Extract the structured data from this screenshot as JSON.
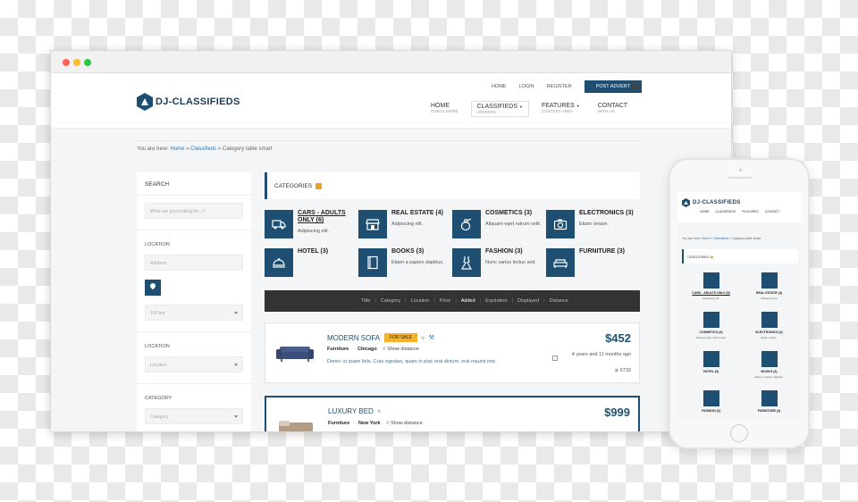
{
  "site": {
    "logo_text": "DJ-CLASSIFIEDS",
    "brand_color": "#1e4f72",
    "accent_color": "#f5b22a"
  },
  "window": {
    "dots": [
      "#ff5f57",
      "#ffbd2e",
      "#28c840"
    ]
  },
  "topnav": {
    "home": "HOME",
    "login": "LOGIN",
    "register": "REGISTER",
    "post_advert": "POST ADVERT"
  },
  "mainnav": [
    {
      "label": "HOME",
      "sub": "CHECK MORE"
    },
    {
      "label": "CLASSIFIEDS",
      "sub": "ADVERTS"
    },
    {
      "label": "FEATURES",
      "sub": "CONTENT AREA"
    },
    {
      "label": "CONTACT",
      "sub": "WITH US"
    }
  ],
  "breadcrumb": {
    "prefix": "You are here:",
    "home": "Home",
    "classifieds": "Classifieds",
    "current": "Category table smart"
  },
  "sidebar": {
    "title": "SEARCH",
    "search_placeholder": "What are you looking for...?",
    "location_label": "LOCATION",
    "address_placeholder": "Address",
    "radius_value": "100 km",
    "location_label2": "LOCATION",
    "location_select": "Location",
    "category_label": "CATEGORY",
    "category_select": "Category"
  },
  "categories": {
    "title": "CATEGORIES",
    "items": [
      {
        "name": "CARS - ADULTS ONLY (6)",
        "desc": "Adipiscing elit.",
        "icon": "truck-icon"
      },
      {
        "name": "REAL ESTATE (4)",
        "desc": "Adipiscing elit.",
        "icon": "store-icon"
      },
      {
        "name": "COSMETICS (3)",
        "desc": "Aliquam eget rutrum velit.",
        "icon": "perfume-icon"
      },
      {
        "name": "ELECTRONICS (3)",
        "desc": "Etiam ornare.",
        "icon": "camera-icon"
      },
      {
        "name": "HOTEL (3)",
        "desc": "",
        "icon": "cloche-icon"
      },
      {
        "name": "BOOKS (3)",
        "desc": "Etiam a sapien dapibus.",
        "icon": "book-icon"
      },
      {
        "name": "FASHION (3)",
        "desc": "Nunc varius lectus sed.",
        "icon": "dress-icon"
      },
      {
        "name": "FURNITURE (3)",
        "desc": "",
        "icon": "sofa-icon"
      }
    ]
  },
  "sortbar": [
    "Title",
    "Category",
    "Location",
    "Price",
    "Added",
    "Expiration",
    "Displayed",
    "Distance"
  ],
  "listings": [
    {
      "title": "MODERN SOFA",
      "badge": "FOR SALE",
      "category": "Furniture",
      "city": "Chicago",
      "distance": "Show distance",
      "desc": "Donec ut quam felis. Cras egestas, quam in plac erat dictum, erat mauris inte.",
      "price": "$452",
      "ago": "4 years and 11 months ago",
      "views": "6733"
    },
    {
      "title": "LUXURY BED",
      "category": "Furniture",
      "city": "New York",
      "distance": "Show distance",
      "price": "$999"
    }
  ],
  "mobile": {
    "logo_text": "DJ-CLASSIFIEDS",
    "nav": [
      "HOME",
      "CLASSIFIEDS",
      "FEATURES",
      "CONTACT"
    ],
    "crumb_prefix": "You are here:",
    "crumb_home": "Home",
    "crumb_classifieds": "Classifieds",
    "crumb_current": "Category table smart",
    "categories_title": "CATEGORIES",
    "categories": [
      {
        "name": "CARS - ADULTS ONLY (6)",
        "desc": "Adipiscing elit."
      },
      {
        "name": "REAL ESTATE (4)",
        "desc": "Adipiscing elit."
      },
      {
        "name": "COSMETICS (3)",
        "desc": "Aliquam eget rutrum velit."
      },
      {
        "name": "ELECTRONICS (3)",
        "desc": "Etiam ornare."
      },
      {
        "name": "HOTEL (3)",
        "desc": ""
      },
      {
        "name": "BOOKS (3)",
        "desc": "Etiam a sapien dapibus."
      },
      {
        "name": "FASHION (3)",
        "desc": ""
      },
      {
        "name": "FURNITURE (3)",
        "desc": ""
      }
    ]
  }
}
